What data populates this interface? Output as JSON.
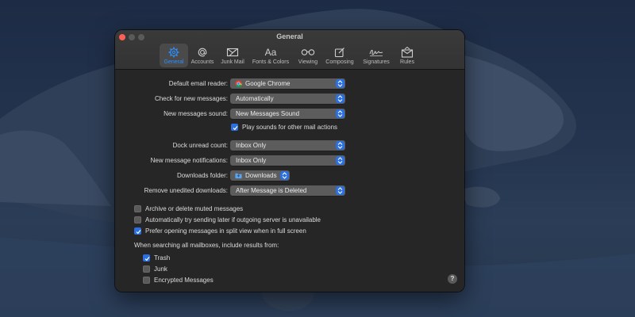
{
  "window": {
    "title": "General"
  },
  "tabs": [
    {
      "label": "General",
      "icon": "gear-icon",
      "active": true
    },
    {
      "label": "Accounts",
      "icon": "at-icon"
    },
    {
      "label": "Junk Mail",
      "icon": "junk-mail-icon"
    },
    {
      "label": "Fonts & Colors",
      "icon": "fonts-icon",
      "glyph": "Aa"
    },
    {
      "label": "Viewing",
      "icon": "glasses-icon"
    },
    {
      "label": "Composing",
      "icon": "compose-icon"
    },
    {
      "label": "Signatures",
      "icon": "signature-icon"
    },
    {
      "label": "Rules",
      "icon": "rules-icon"
    }
  ],
  "settings": {
    "default_reader": {
      "label": "Default email reader:",
      "value": "Google Chrome",
      "icon": "chrome-icon"
    },
    "check_new": {
      "label": "Check for new messages:",
      "value": "Automatically"
    },
    "new_sound": {
      "label": "New messages sound:",
      "value": "New Messages Sound"
    },
    "play_sounds": {
      "label": "Play sounds for other mail actions",
      "checked": true
    },
    "dock_unread": {
      "label": "Dock unread count:",
      "value": "Inbox Only"
    },
    "notifications": {
      "label": "New message notifications:",
      "value": "Inbox Only"
    },
    "downloads_folder": {
      "label": "Downloads folder:",
      "value": "Downloads",
      "icon": "folder-icon"
    },
    "remove_unedited": {
      "label": "Remove unedited downloads:",
      "value": "After Message is Deleted"
    }
  },
  "options": [
    {
      "label": "Archive or delete muted messages",
      "checked": false
    },
    {
      "label": "Automatically try sending later if outgoing server is unavailable",
      "checked": false
    },
    {
      "label": "Prefer opening messages in split view when in full screen",
      "checked": true
    }
  ],
  "search": {
    "heading": "When searching all mailboxes, include results from:",
    "items": [
      {
        "label": "Trash",
        "checked": true
      },
      {
        "label": "Junk",
        "checked": false
      },
      {
        "label": "Encrypted Messages",
        "checked": false
      }
    ]
  },
  "help": {
    "label": "?"
  },
  "colors": {
    "accent": "#2b6fe0",
    "window_bg": "#262626",
    "toolbar_bg": "#363636",
    "active_tab_text": "#2e8fff"
  }
}
